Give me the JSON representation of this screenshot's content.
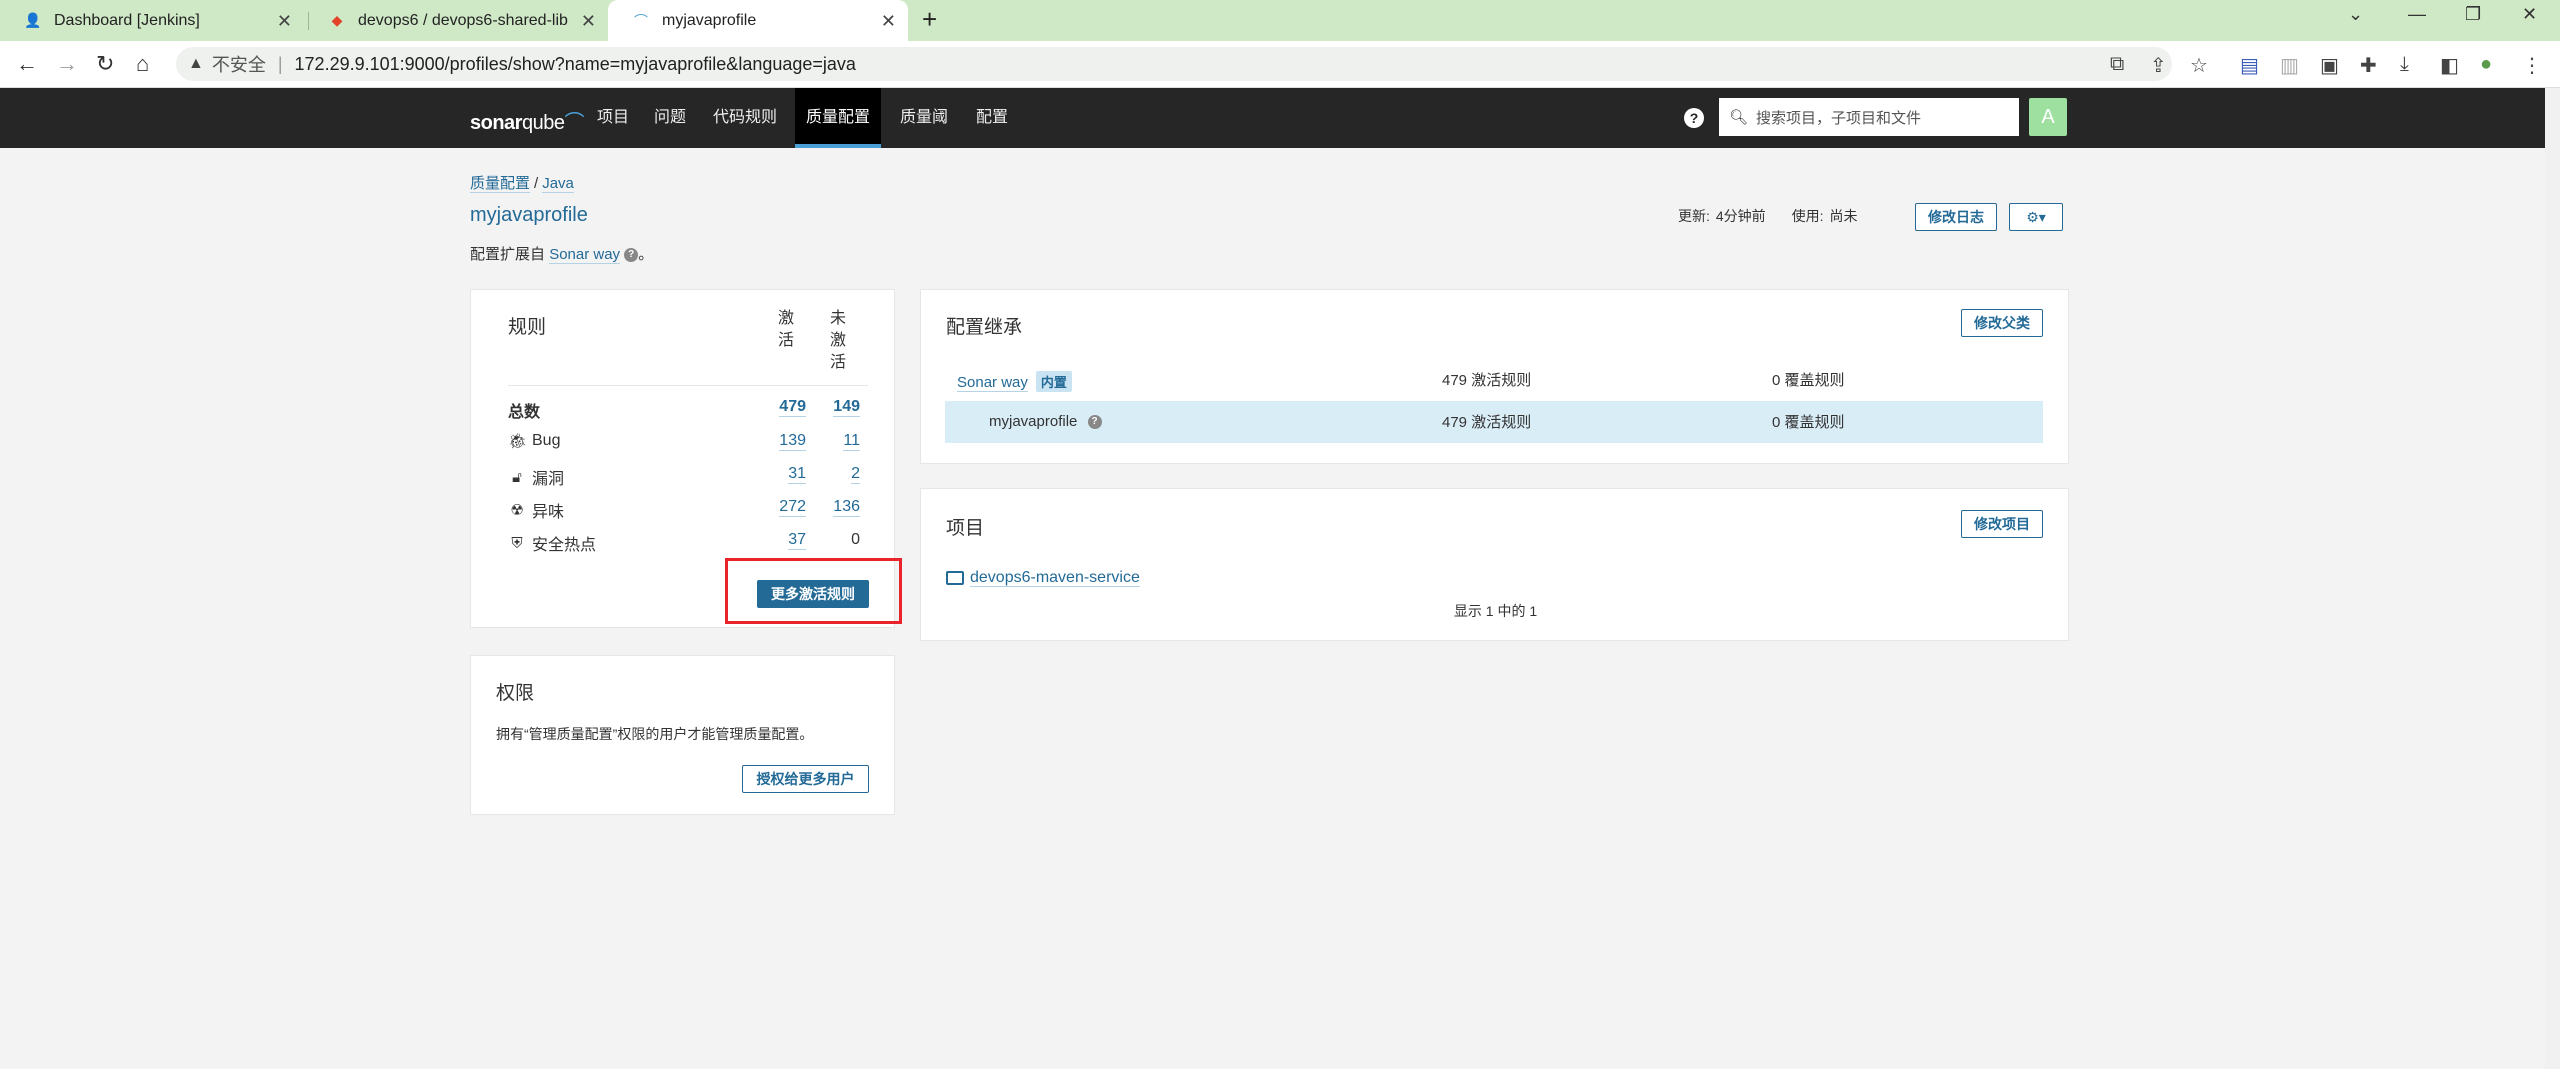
{
  "browser": {
    "tabs": [
      {
        "title": "Dashboard [Jenkins]",
        "icon": "jenkins-icon"
      },
      {
        "title": "devops6 / devops6-shared-lib",
        "icon": "gitlab-icon"
      },
      {
        "title": "myjavaprofile",
        "icon": "sonar-icon"
      }
    ],
    "insecure_label": "不安全",
    "url": "172.29.9.101:9000/profiles/show?name=myjavaprofile&language=java"
  },
  "nav": {
    "logo_sonar": "sonar",
    "logo_qube": "qube",
    "items": [
      "项目",
      "问题",
      "代码规则",
      "质量配置",
      "质量阈",
      "配置"
    ],
    "search_placeholder": "搜索项目，子项目和文件",
    "avatar_letter": "A"
  },
  "page": {
    "breadcrumb_root": "质量配置",
    "breadcrumb_lang": "Java",
    "title": "myjavaprofile",
    "extends_prefix": "配置扩展自",
    "extends_link": "Sonar way",
    "extends_suffix": "。",
    "updated_label": "更新:",
    "updated_value": "4分钟前",
    "used_label": "使用:",
    "used_value": "尚未",
    "changelog_btn": "修改日志",
    "settings_caret": "▾"
  },
  "rules": {
    "title": "规则",
    "col_active": "激活",
    "col_inactive": "未激活",
    "rows": [
      {
        "name": "总数",
        "icon": "",
        "active": "479",
        "inactive": "149"
      },
      {
        "name": "Bug",
        "icon": "bug-icon",
        "active": "139",
        "inactive": "11"
      },
      {
        "name": "漏洞",
        "icon": "lock-icon",
        "active": "31",
        "inactive": "2"
      },
      {
        "name": "异味",
        "icon": "code-smell-icon",
        "active": "272",
        "inactive": "136"
      },
      {
        "name": "安全热点",
        "icon": "shield-icon",
        "active": "37",
        "inactive": "0"
      }
    ],
    "activate_more_btn": "更多激活规则"
  },
  "permissions": {
    "title": "权限",
    "desc": "拥有“管理质量配置”权限的用户才能管理质量配置。",
    "grant_btn": "授权给更多用户"
  },
  "inheritance": {
    "title": "配置继承",
    "change_parent_btn": "修改父类",
    "rows": [
      {
        "name": "Sonar way",
        "tag": "内置",
        "active": "479 激活规则",
        "overrides": "0 覆盖规则"
      },
      {
        "name": "myjavaprofile",
        "tag": "",
        "active": "479 激活规则",
        "overrides": "0 覆盖规则"
      }
    ]
  },
  "projects": {
    "title": "项目",
    "change_btn": "修改项目",
    "items": [
      "devops6-maven-service"
    ],
    "count_text": "显示 1 中的 1"
  }
}
